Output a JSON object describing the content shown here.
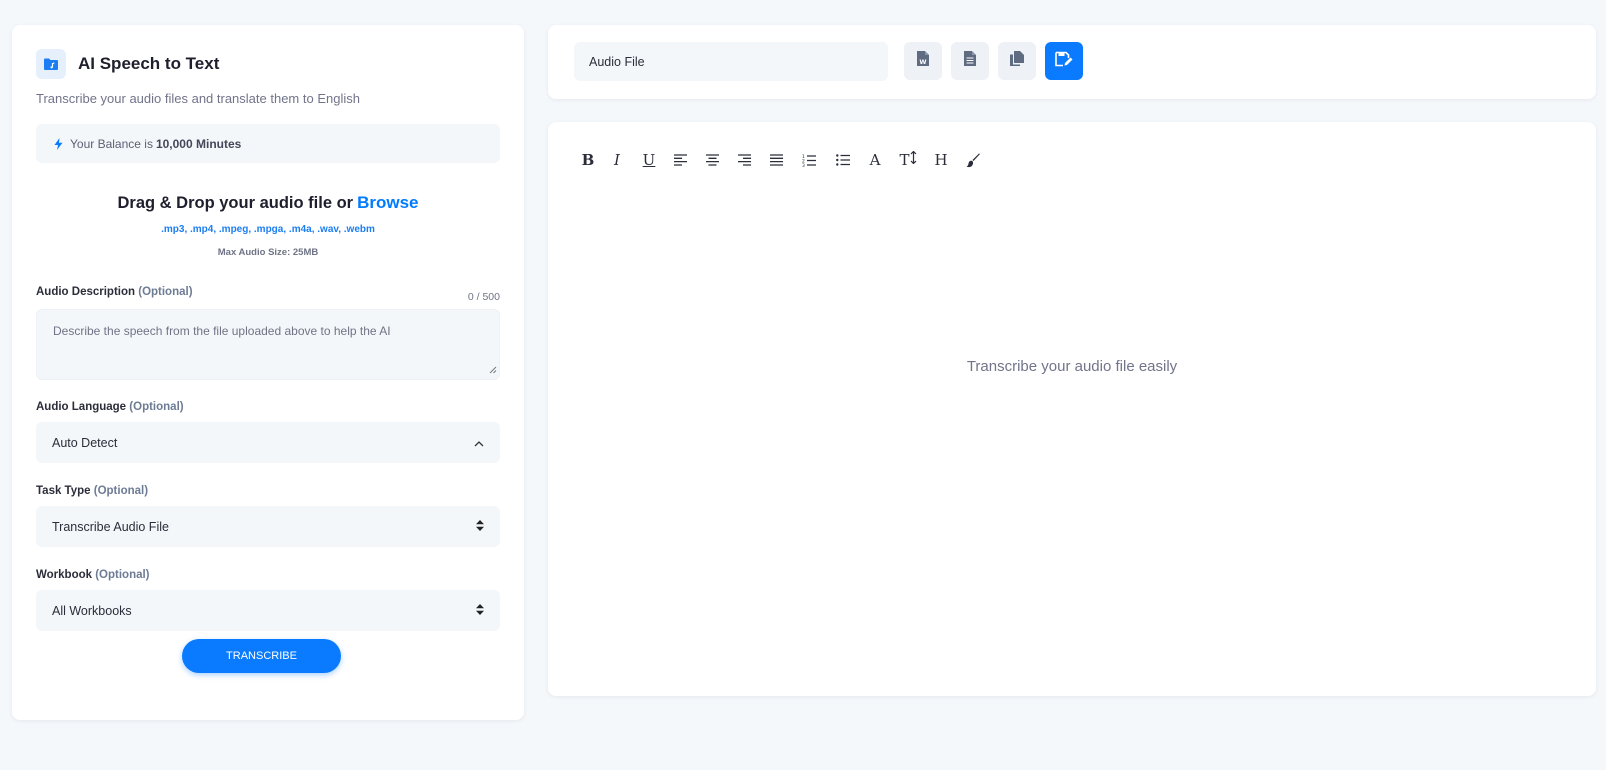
{
  "app": {
    "title": "AI Speech to Text",
    "subtitle": "Transcribe your audio files and translate them to English",
    "icon": "music-folder-icon"
  },
  "balance": {
    "prefix": "Your Balance is",
    "value": "10,000 Minutes"
  },
  "upload": {
    "title": "Drag & Drop your audio file or",
    "browse_label": "Browse",
    "formats": ".mp3, .mp4, .mpeg, .mpga, .m4a, .wav, .webm",
    "max_size": "Max Audio Size: 25MB"
  },
  "description": {
    "label": "Audio Description",
    "optional": "(Optional)",
    "counter": "0 / 500",
    "placeholder": "Describe the speech from the file uploaded above to help the AI"
  },
  "language": {
    "label": "Audio Language",
    "optional": "(Optional)",
    "value": "Auto Detect"
  },
  "task_type": {
    "label": "Task Type",
    "optional": "(Optional)",
    "value": "Transcribe Audio File"
  },
  "workbook": {
    "label": "Workbook",
    "optional": "(Optional)",
    "value": "All Workbooks"
  },
  "transcribe_label": "TRANSCRIBE",
  "top_bar": {
    "file_name": "Audio File",
    "buttons": [
      "word-document-icon",
      "text-document-icon",
      "copy-icon",
      "save-icon"
    ]
  },
  "editor": {
    "placeholder": "Transcribe your audio file easily",
    "toolbar": {
      "bold": "B",
      "italic": "I",
      "underline": "U",
      "font": "A",
      "font_size": "T",
      "heading": "H"
    }
  },
  "colors": {
    "accent": "#0a7bff",
    "background": "#f5f8fb",
    "field_bg": "#f4f7fa",
    "muted_text": "#71748a"
  }
}
